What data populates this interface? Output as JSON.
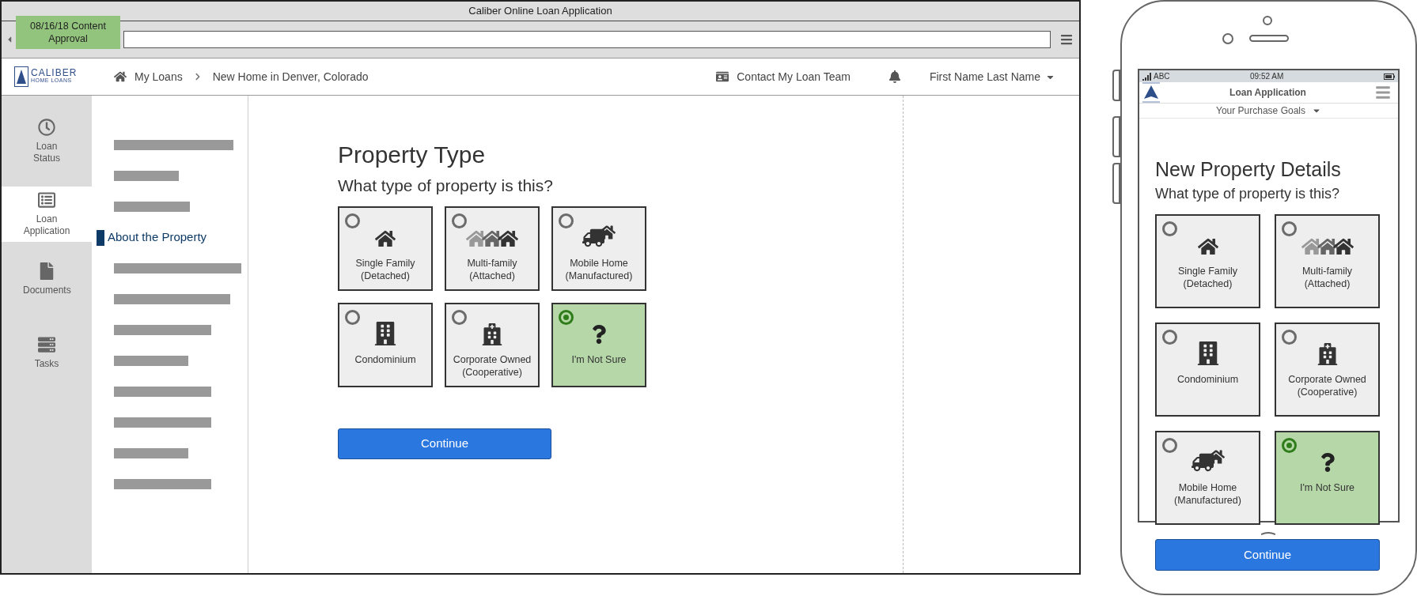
{
  "note": {
    "text": "08/16/18 Content Approval"
  },
  "browser": {
    "title": "Caliber Online Loan Application"
  },
  "header": {
    "logo": [
      "CALIBER",
      "HOME LOANS"
    ],
    "breadcrumbs": [
      "My Loans",
      "New Home in Denver, Colorado"
    ],
    "contact": "Contact My Loan Team",
    "user": "First Name Last Name"
  },
  "rail": [
    {
      "kind": "clock",
      "label": "Loan Status",
      "selected": false
    },
    {
      "kind": "form",
      "label": "Loan Application",
      "selected": true
    },
    {
      "kind": "file",
      "label": "Documents",
      "selected": false
    },
    {
      "kind": "stack",
      "label": "Tasks",
      "selected": false
    }
  ],
  "subnav": [
    {
      "kind": "bar"
    },
    {
      "kind": "bar"
    },
    {
      "kind": "bar"
    },
    {
      "kind": "link",
      "label": "About the Property",
      "selected": true
    },
    {
      "kind": "bar"
    },
    {
      "kind": "bar"
    },
    {
      "kind": "bar"
    },
    {
      "kind": "bar"
    },
    {
      "kind": "bar"
    },
    {
      "kind": "bar"
    },
    {
      "kind": "bar"
    },
    {
      "kind": "bar"
    }
  ],
  "form": {
    "title": "Property Type",
    "question": "What type of property is this?",
    "options": [
      {
        "kind": "single",
        "label": "Single Family\n(Detached)",
        "selected": false
      },
      {
        "kind": "multi",
        "label": "Multi-family\n(Attached)",
        "selected": false
      },
      {
        "kind": "mobile",
        "label": "Mobile Home\n(Manufactured)",
        "selected": false
      },
      {
        "kind": "condo",
        "label": "Condominium",
        "selected": false
      },
      {
        "kind": "coop",
        "label": "Corporate Owned\n(Cooperative)",
        "selected": false
      },
      {
        "kind": "unsure",
        "label": "I'm Not Sure",
        "selected": true
      }
    ],
    "button": "Continue"
  },
  "phone": {
    "carrier": "ABC",
    "time": "09:52 AM",
    "title": "Loan Application",
    "step": "Your Purchase Goals",
    "heading": "New Property Details",
    "question": "What type of property is this?",
    "options": [
      {
        "kind": "single",
        "label": "Single Family\n(Detached)",
        "selected": false
      },
      {
        "kind": "multi",
        "label": "Multi-family\n(Attached)",
        "selected": false
      },
      {
        "kind": "condo",
        "label": "Condominium",
        "selected": false
      },
      {
        "kind": "coop",
        "label": "Corporate Owned\n(Cooperative)",
        "selected": false
      },
      {
        "kind": "mobile",
        "label": "Mobile Home\n(Manufactured)",
        "selected": false
      },
      {
        "kind": "unsure",
        "label": "I'm Not Sure",
        "selected": true
      }
    ],
    "button": "Continue"
  }
}
